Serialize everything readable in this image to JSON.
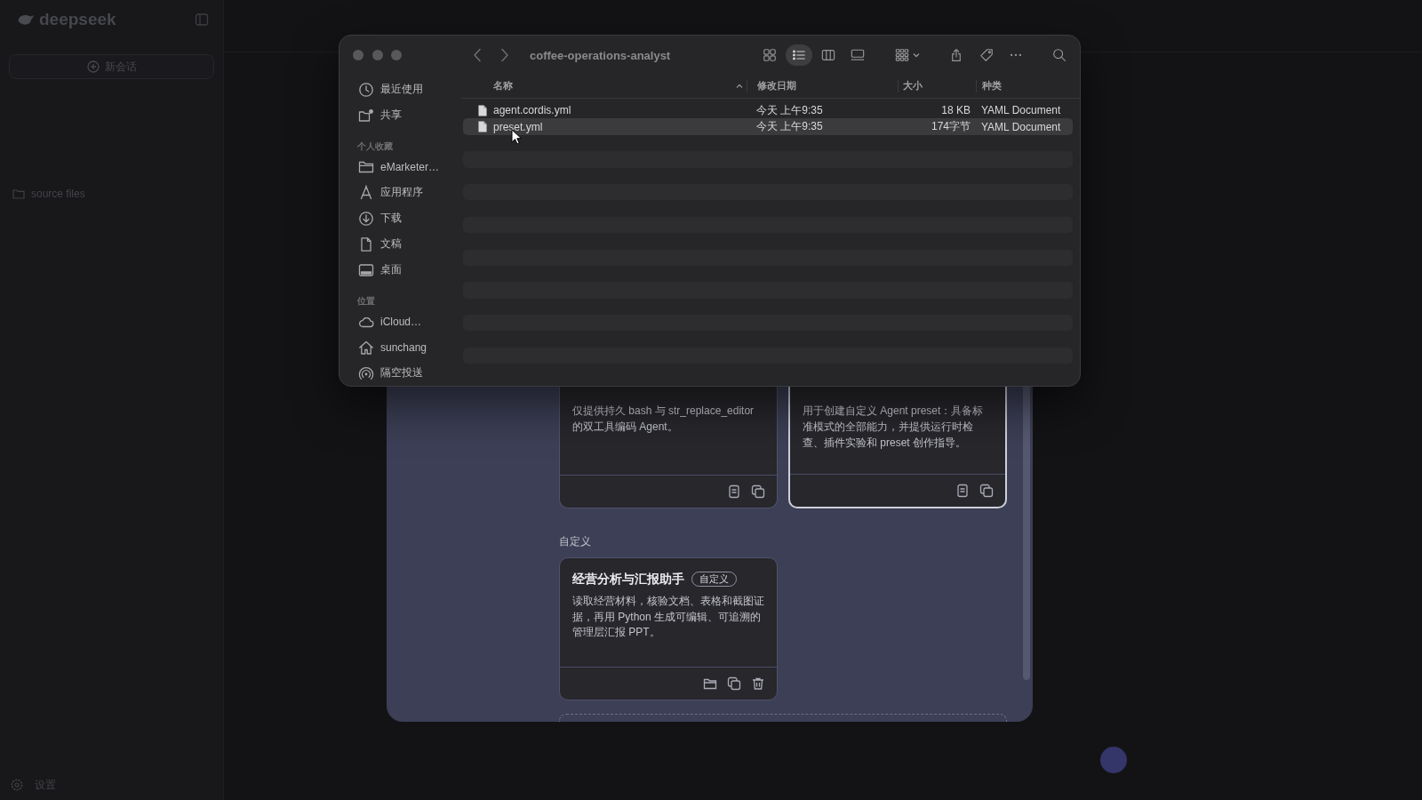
{
  "app_sidebar": {
    "logo_text": "deepseek",
    "new_chat_button": "新会话",
    "folder_item": "source files",
    "settings_item": "设置"
  },
  "finder_window": {
    "title": "coffee-operations-analyst",
    "view_modes": [
      {
        "kind": "grid",
        "selected": false
      },
      {
        "kind": "list",
        "selected": true
      },
      {
        "kind": "columns",
        "selected": false
      },
      {
        "kind": "gallery",
        "selected": false
      }
    ],
    "actions": [
      {
        "kind": "group"
      },
      {
        "kind": "share"
      },
      {
        "kind": "tag"
      },
      {
        "kind": "more"
      },
      {
        "kind": "search"
      }
    ],
    "sidebar": [
      {
        "kind": "recents",
        "label": "最近使用"
      },
      {
        "kind": "shared",
        "label": "共享"
      },
      {
        "kind": "section",
        "label": "个人收藏"
      },
      {
        "kind": "folder",
        "label": "eMarketer…"
      },
      {
        "kind": "apps",
        "label": "应用程序"
      },
      {
        "kind": "downloads",
        "label": "下载"
      },
      {
        "kind": "documents",
        "label": "文稿"
      },
      {
        "kind": "desktop",
        "label": "桌面"
      },
      {
        "kind": "section",
        "label": "位置"
      },
      {
        "kind": "icloud",
        "label": "iCloud…"
      },
      {
        "kind": "home",
        "label": "sunchang"
      },
      {
        "kind": "airdrop",
        "label": "隔空投送"
      }
    ],
    "columns": [
      {
        "label": "名称",
        "sorted": true
      },
      {
        "label": "修改日期",
        "sorted": false
      },
      {
        "label": "大小",
        "sorted": false
      },
      {
        "label": "种类",
        "sorted": false
      }
    ],
    "files": [
      {
        "name": "agent.cordis.yml",
        "modified": "今天 上午9:35",
        "size": "18 KB",
        "file_type": "YAML Document",
        "selected": false
      },
      {
        "name": "preset.yml",
        "modified": "今天 上午9:35",
        "size": "174字节",
        "file_type": "YAML Document",
        "selected": true
      }
    ]
  },
  "preset_dialog": {
    "cards": [
      {
        "description": "仅提供持久 bash 与 str_replace_editor 的双工具编码 Agent。",
        "selected": false,
        "actions": [
          {
            "kind": "view"
          },
          {
            "kind": "copy"
          }
        ]
      },
      {
        "description": "用于创建自定义 Agent preset：具备标准模式的全部能力，并提供运行时检查、插件实验和 preset 创作指导。",
        "selected": true,
        "actions": [
          {
            "kind": "view"
          },
          {
            "kind": "copy"
          }
        ]
      }
    ],
    "custom_section": {
      "heading": "自定义",
      "cards": [
        {
          "title": "经营分析与汇报助手",
          "badge": "自定义",
          "description": "读取经营材料，核验文档、表格和截图证据，再用 Python 生成可编辑、可追溯的管理层汇报 PPT。",
          "selected": false,
          "actions": [
            {
              "kind": "open_folder"
            },
            {
              "kind": "copy"
            },
            {
              "kind": "delete"
            }
          ]
        }
      ]
    }
  }
}
